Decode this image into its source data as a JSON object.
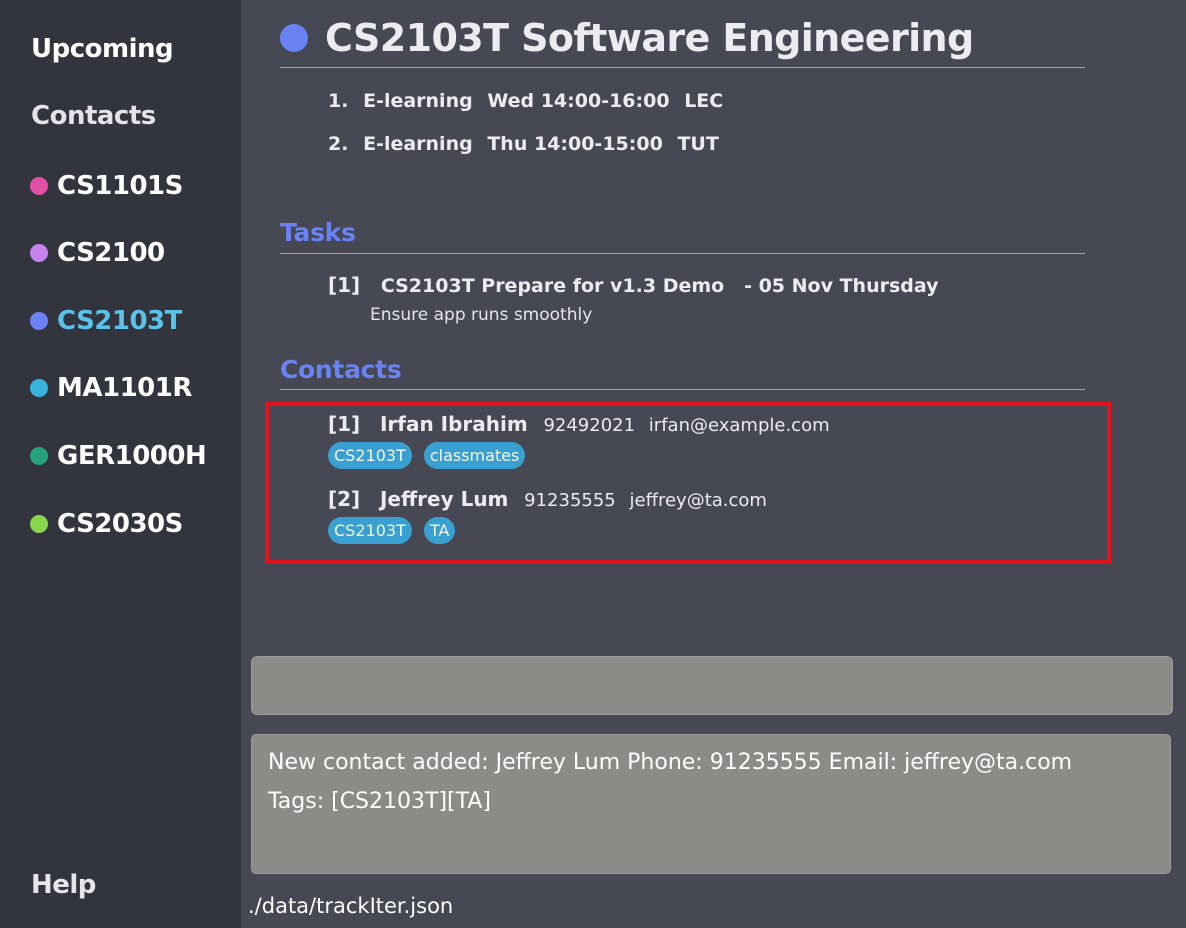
{
  "sidebar": {
    "upcoming": "Upcoming",
    "contacts": "Contacts",
    "modules": [
      {
        "code": "CS1101S",
        "color": "#e14fa6"
      },
      {
        "code": "CS2100",
        "color": "#c483ec"
      },
      {
        "code": "CS2103T",
        "color": "#6b82f5",
        "selected": true,
        "selected_color": "#5bc2ea"
      },
      {
        "code": "MA1101R",
        "color": "#38b3de"
      },
      {
        "code": "GER1000H",
        "color": "#27a17a"
      },
      {
        "code": "CS2030S",
        "color": "#8cd64d"
      }
    ],
    "help": "Help"
  },
  "module": {
    "title": "CS2103T Software Engineering",
    "color": "#6b82f5",
    "lessons": [
      {
        "num": "1.",
        "venue": "E-learning",
        "time": "Wed 14:00-16:00",
        "type": "LEC"
      },
      {
        "num": "2.",
        "venue": "E-learning",
        "time": "Thu 14:00-15:00",
        "type": "TUT"
      }
    ]
  },
  "tasks": {
    "heading": "Tasks",
    "items": [
      {
        "index": "[1]",
        "title": "CS2103T Prepare for v1.3 Demo",
        "date": "- 05 Nov Thursday",
        "description": "Ensure app runs smoothly"
      }
    ]
  },
  "contacts": {
    "heading": "Contacts",
    "items": [
      {
        "index": "[1]",
        "name": "Irfan Ibrahim",
        "phone": "92492021",
        "email": "irfan@example.com",
        "tags": [
          "CS2103T",
          "classmates"
        ]
      },
      {
        "index": "[2]",
        "name": "Jeffrey Lum",
        "phone": "91235555",
        "email": "jeffrey@ta.com",
        "tags": [
          "CS2103T",
          "TA"
        ]
      }
    ]
  },
  "command": {
    "value": ""
  },
  "result": {
    "line1": "New contact added: Jeffrey Lum Phone: 91235555 Email: jeffrey@ta.com",
    "line2": "Tags: [CS2103T][TA]"
  },
  "status": {
    "file_path": "./data/trackIter.json"
  },
  "colors": {
    "highlight": "#e3121b",
    "tag": "#3aa0d2",
    "accent": "#6b82f5"
  }
}
